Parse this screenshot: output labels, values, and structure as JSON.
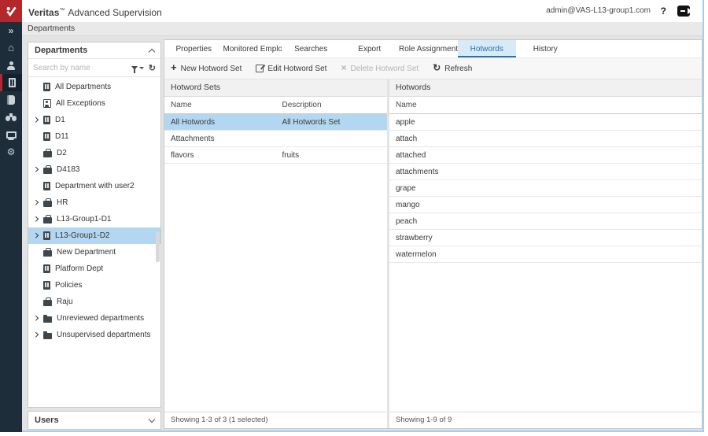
{
  "header": {
    "brand": "Veritas",
    "trademark": "™",
    "product": "Advanced Supervision",
    "user_email": "admin@VAS-L13-group1.com",
    "help_label": "?"
  },
  "breadcrumb": "Departments",
  "sidebar": {
    "icons": [
      "chevron-double-right",
      "home",
      "user",
      "department",
      "notebook",
      "binoculars",
      "monitor",
      "gears"
    ],
    "selected": "department"
  },
  "departments_panel": {
    "title": "Departments",
    "search_placeholder": "Search by name",
    "items": [
      {
        "label": "All Departments",
        "icon": "building",
        "expandable": false,
        "selected": false
      },
      {
        "label": "All Exceptions",
        "icon": "exception",
        "expandable": false,
        "selected": false
      },
      {
        "label": "D1",
        "icon": "building",
        "expandable": true,
        "selected": false
      },
      {
        "label": "D11",
        "icon": "building",
        "expandable": false,
        "selected": false
      },
      {
        "label": "D2",
        "icon": "briefcase",
        "expandable": false,
        "selected": false
      },
      {
        "label": "D4183",
        "icon": "briefcase",
        "expandable": true,
        "selected": false
      },
      {
        "label": "Department with user2",
        "icon": "building",
        "expandable": false,
        "selected": false
      },
      {
        "label": "HR",
        "icon": "briefcase",
        "expandable": true,
        "selected": false
      },
      {
        "label": "L13-Group1-D1",
        "icon": "briefcase",
        "expandable": true,
        "selected": false
      },
      {
        "label": "L13-Group1-D2",
        "icon": "building",
        "expandable": true,
        "selected": true
      },
      {
        "label": "New Department",
        "icon": "briefcase",
        "expandable": false,
        "selected": false
      },
      {
        "label": "Platform Dept",
        "icon": "building",
        "expandable": false,
        "selected": false
      },
      {
        "label": "Policies",
        "icon": "building",
        "expandable": false,
        "selected": false
      },
      {
        "label": "Raju",
        "icon": "briefcase",
        "expandable": false,
        "selected": false
      },
      {
        "label": "Unreviewed departments",
        "icon": "folder",
        "expandable": true,
        "selected": false
      },
      {
        "label": "Unsupervised departments",
        "icon": "folder",
        "expandable": true,
        "selected": false
      }
    ]
  },
  "users_panel": {
    "title": "Users"
  },
  "tabs": [
    {
      "label": "Properties",
      "active": false
    },
    {
      "label": "Monitored Employees",
      "active": false
    },
    {
      "label": "Searches",
      "active": false
    },
    {
      "label": "Export",
      "active": false
    },
    {
      "label": "Role Assignment",
      "active": false
    },
    {
      "label": "Hotwords",
      "active": true
    },
    {
      "label": "History",
      "active": false
    }
  ],
  "toolbar": {
    "new_label": "New Hotword Set",
    "edit_label": "Edit Hotword Set",
    "delete_label": "Delete Hotword Set",
    "refresh_label": "Refresh"
  },
  "hotword_sets": {
    "title": "Hotword Sets",
    "columns": [
      "Name",
      "Description"
    ],
    "rows": [
      {
        "name": "All Hotwords",
        "description": "All Hotwords Set",
        "selected": true
      },
      {
        "name": "Attachments",
        "description": "",
        "selected": false
      },
      {
        "name": "flavors",
        "description": "fruits",
        "selected": false
      }
    ],
    "status": "Showing 1-3 of 3 (1 selected)"
  },
  "hotwords": {
    "title": "Hotwords",
    "columns": [
      "Name"
    ],
    "rows": [
      "apple",
      "attach",
      "attached",
      "attachments",
      "grape",
      "mango",
      "peach",
      "strawberry",
      "watermelon"
    ],
    "status": "Showing 1-9 of 9"
  },
  "colors": {
    "brand_red": "#B3282D",
    "sidebar_bg": "#1D2D39",
    "selection_blue": "#B3D7F1",
    "tab_active_bg": "#D8EAF7",
    "tab_active_accent": "#2373B5",
    "window_edge_blue": "#A9CCEA"
  }
}
